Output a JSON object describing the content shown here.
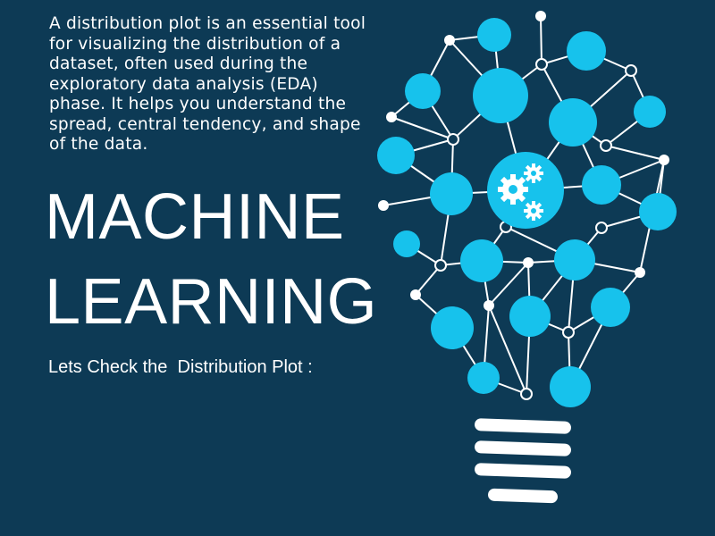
{
  "intro_text": "A distribution plot is an essential tool for visualizing the distribution of a dataset, often used during the exploratory data analysis (EDA) phase. It helps you understand the spread, central tendency, and shape of the data.",
  "headline": {
    "line1": "MACHINE",
    "line2": "LEARNING"
  },
  "subtitle": "Lets Check the  Distribution Plot :",
  "colors": {
    "background": "#0d3a55",
    "node": "#17c2ec",
    "line": "#ffffff",
    "text": "#ffffff"
  },
  "icons": {
    "illustration": "lightbulb-neural-network-icon",
    "center": "gears-icon"
  }
}
